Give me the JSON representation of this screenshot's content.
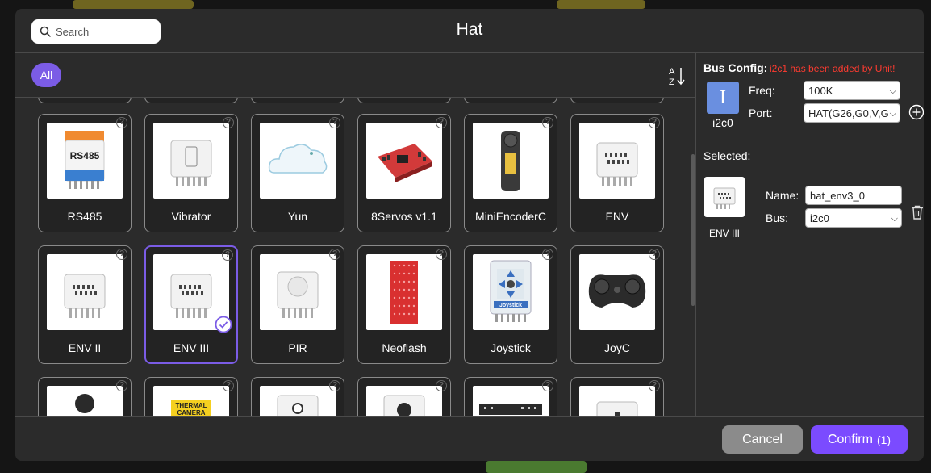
{
  "colors": {
    "accent": "#7b5ce6",
    "confirm": "#7b4bff",
    "warning": "#ff3b30",
    "cancel": "#8b8b8b"
  },
  "dialog": {
    "title": "Hat"
  },
  "search": {
    "placeholder": "Search",
    "icon": "search-icon"
  },
  "filter": {
    "all_label": "All",
    "sort_icon": "sort-az-icon"
  },
  "cards": [
    {
      "label": "RS485"
    },
    {
      "label": "Vibrator"
    },
    {
      "label": "Yun"
    },
    {
      "label": "8Servos v1.1"
    },
    {
      "label": "MiniEncoderC"
    },
    {
      "label": "ENV"
    },
    {
      "label": "ENV II"
    },
    {
      "label": "ENV III",
      "selected": true
    },
    {
      "label": "PIR"
    },
    {
      "label": "Neoflash"
    },
    {
      "label": "Joystick"
    },
    {
      "label": "JoyC"
    }
  ],
  "thumb_text": {
    "rs485": "RS485",
    "thermal": "THERMAL\nCAMERA",
    "joystick": "Joystick"
  },
  "bus_config": {
    "title": "Bus Config:",
    "warning": "i2c1 has been added by Unit!",
    "bus_icon_letter": "I",
    "bus_name": "i2c0",
    "freq_label": "Freq:",
    "freq_value": "100K",
    "port_label": "Port:",
    "port_value": "HAT(G26,G0,V,G"
  },
  "selected_panel": {
    "title": "Selected:",
    "item_label": "ENV III",
    "name_label": "Name:",
    "name_value": "hat_env3_0",
    "bus_label": "Bus:",
    "bus_value": "i2c0"
  },
  "footer": {
    "cancel_label": "Cancel",
    "confirm_label": "Confirm",
    "confirm_count": "(1)"
  }
}
